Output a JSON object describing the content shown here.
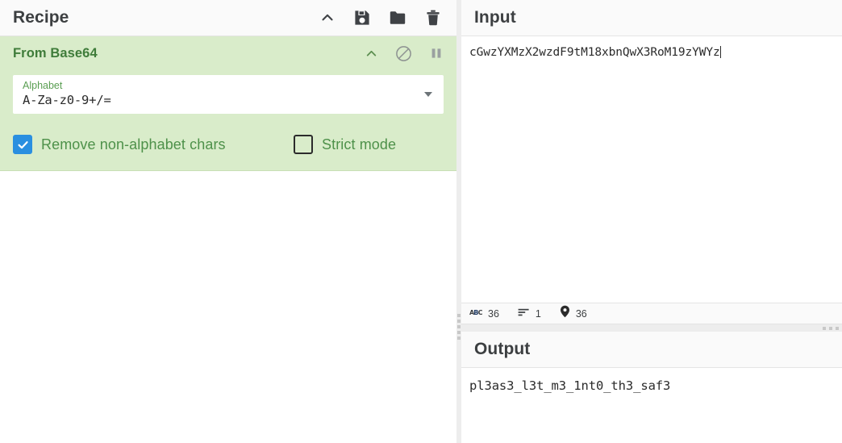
{
  "recipe": {
    "title": "Recipe",
    "icons": [
      {
        "name": "collapse-chevron-up-icon",
        "glyph": "chevron-up"
      },
      {
        "name": "save-recipe-icon",
        "glyph": "floppy-disk"
      },
      {
        "name": "load-recipe-icon",
        "glyph": "folder"
      },
      {
        "name": "clear-recipe-icon",
        "glyph": "trash"
      }
    ],
    "operation": {
      "name": "From Base64",
      "header_icons": [
        {
          "name": "operation-collapse-icon",
          "glyph": "chevron-up"
        },
        {
          "name": "operation-disable-icon",
          "glyph": "circle-slash"
        },
        {
          "name": "operation-breakpoint-icon",
          "glyph": "pause"
        }
      ],
      "argument": {
        "label": "Alphabet",
        "value": "A-Za-z0-9+/="
      },
      "checkboxes": [
        {
          "label": "Remove non-alphabet chars",
          "checked": true
        },
        {
          "label": "Strict mode",
          "checked": false
        }
      ]
    }
  },
  "input": {
    "title": "Input",
    "value": "cGwzYXMzX2wzdF9tM18xbnQwX3RoM19zYWYz",
    "status": {
      "length_icon": "abc-icon",
      "length": "36",
      "lines_icon": "lines-icon",
      "lines": "1",
      "position_icon": "map-pin-icon",
      "position": "36"
    }
  },
  "output": {
    "title": "Output",
    "value": "pl3as3_l3t_m3_1nt0_th3_saf3"
  },
  "colors": {
    "operation_bg": "#d9ecca",
    "operation_title": "#3f7c3a",
    "checkbox_checked": "#2a8fe0",
    "checkbox_label": "#4e914a",
    "arg_label": "#5a9e52",
    "panel_header_bg": "#fafafa",
    "splitter": "#ededed",
    "text": "#2b2b2b"
  }
}
